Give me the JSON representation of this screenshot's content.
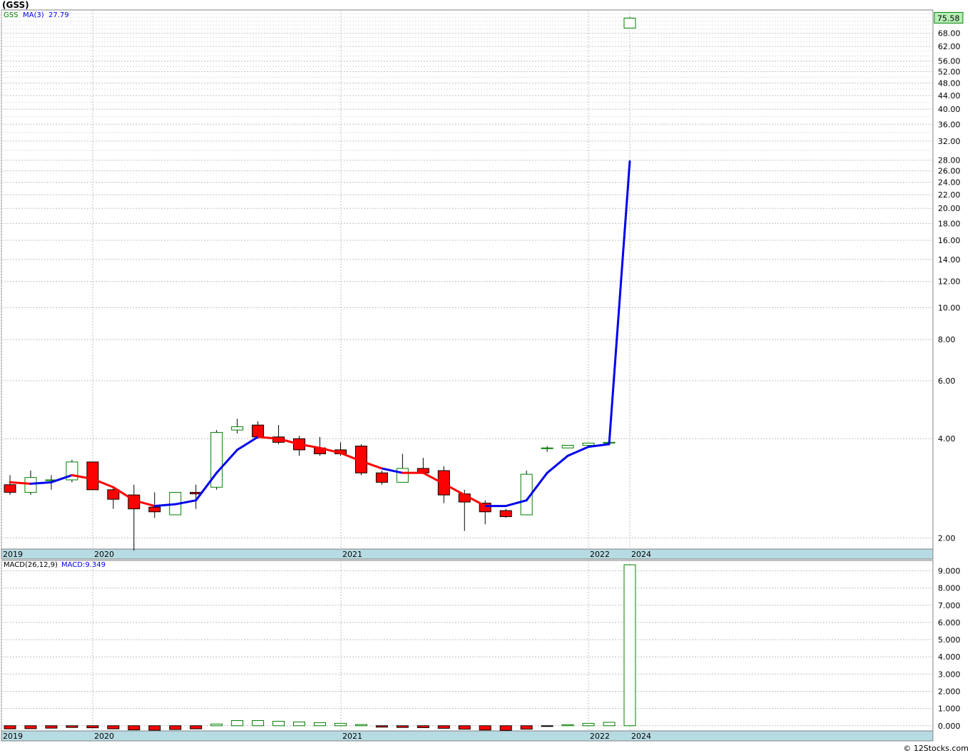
{
  "header": {
    "title": "(GSS)"
  },
  "footer": {
    "credit": "© 12Stocks.com"
  },
  "chart_data": [
    {
      "type": "candlestick",
      "legend": {
        "symbol": "GSS",
        "ma_label": "MA(3)",
        "ma_value": "27.79"
      },
      "last_price_label": "75.58",
      "y_scale": "log",
      "ylim": [
        1.85,
        80
      ],
      "y_ticks": [
        "68.00",
        "62.00",
        "56.00",
        "52.00",
        "48.00",
        "44.00",
        "40.00",
        "36.00",
        "32.00",
        "28.00",
        "26.00",
        "24.00",
        "22.00",
        "20.00",
        "18.00",
        "16.00",
        "14.00",
        "12.00",
        "10.00",
        "8.00",
        "6.00",
        "4.00",
        "2.00"
      ],
      "x_labels": [
        "2019",
        "2020",
        "2021",
        "2022",
        "2024"
      ],
      "colors": {
        "up": "#008000",
        "down": "#ff0000",
        "ma_up": "#0000ee",
        "ma_down": "#ff0000",
        "grid": "#c0c0c0",
        "axis_band": "#b7dbe3",
        "last_price_bg": "#b7f0b7"
      },
      "candles": [
        {
          "o": 2.9,
          "h": 3.1,
          "l": 2.7,
          "c": 2.75
        },
        {
          "o": 2.75,
          "h": 3.2,
          "l": 2.7,
          "c": 3.05
        },
        {
          "o": 3.0,
          "h": 3.1,
          "l": 2.8,
          "c": 3.0
        },
        {
          "o": 3.0,
          "h": 3.45,
          "l": 2.95,
          "c": 3.4
        },
        {
          "o": 3.4,
          "h": 3.4,
          "l": 2.8,
          "c": 2.8
        },
        {
          "o": 2.8,
          "h": 2.85,
          "l": 2.45,
          "c": 2.62
        },
        {
          "o": 2.7,
          "h": 2.9,
          "l": 1.83,
          "c": 2.45
        },
        {
          "o": 2.48,
          "h": 2.75,
          "l": 2.3,
          "c": 2.4
        },
        {
          "o": 2.35,
          "h": 2.7,
          "l": 2.35,
          "c": 2.75
        },
        {
          "o": 2.75,
          "h": 2.9,
          "l": 2.45,
          "c": 2.72
        },
        {
          "o": 2.85,
          "h": 4.25,
          "l": 2.8,
          "c": 4.18
        },
        {
          "o": 4.25,
          "h": 4.6,
          "l": 4.15,
          "c": 4.35
        },
        {
          "o": 4.4,
          "h": 4.52,
          "l": 4.0,
          "c": 4.05
        },
        {
          "o": 4.05,
          "h": 4.4,
          "l": 3.85,
          "c": 3.9
        },
        {
          "o": 4.0,
          "h": 4.08,
          "l": 3.55,
          "c": 3.7
        },
        {
          "o": 3.75,
          "h": 4.05,
          "l": 3.55,
          "c": 3.6
        },
        {
          "o": 3.7,
          "h": 3.9,
          "l": 3.55,
          "c": 3.6
        },
        {
          "o": 3.8,
          "h": 3.85,
          "l": 3.1,
          "c": 3.15
        },
        {
          "o": 3.15,
          "h": 3.2,
          "l": 2.9,
          "c": 2.95
        },
        {
          "o": 2.95,
          "h": 3.6,
          "l": 2.95,
          "c": 3.25
        },
        {
          "o": 3.25,
          "h": 3.5,
          "l": 3.15,
          "c": 3.15
        },
        {
          "o": 3.2,
          "h": 3.3,
          "l": 2.55,
          "c": 2.7
        },
        {
          "o": 2.72,
          "h": 2.8,
          "l": 2.1,
          "c": 2.57
        },
        {
          "o": 2.55,
          "h": 2.6,
          "l": 2.2,
          "c": 2.4
        },
        {
          "o": 2.42,
          "h": 2.45,
          "l": 2.3,
          "c": 2.32
        },
        {
          "o": 2.35,
          "h": 3.2,
          "l": 2.35,
          "c": 3.12
        },
        {
          "o": 3.75,
          "h": 3.8,
          "l": 3.65,
          "c": 3.75
        },
        {
          "o": 3.75,
          "h": 3.82,
          "l": 3.75,
          "c": 3.82
        },
        {
          "o": 3.82,
          "h": 3.88,
          "l": 3.82,
          "c": 3.88
        },
        {
          "o": 3.88,
          "h": 3.9,
          "l": 3.88,
          "c": 3.9
        },
        {
          "o": 70.5,
          "h": 76.0,
          "l": 70.5,
          "c": 75.58
        }
      ],
      "ma": [
        2.95,
        2.92,
        2.95,
        3.1,
        3.02,
        2.85,
        2.6,
        2.5,
        2.53,
        2.6,
        3.15,
        3.7,
        4.05,
        null,
        null,
        null,
        null,
        null,
        3.25,
        3.15,
        3.15,
        null,
        null,
        2.5,
        2.5,
        2.6,
        3.15,
        3.55,
        3.78,
        3.85,
        27.79
      ],
      "ma_colors": [
        "down",
        "down",
        "up",
        "up",
        "down",
        "down",
        "down",
        "down",
        "up",
        "up",
        "up",
        "up",
        "up",
        "down",
        "down",
        "down",
        "down",
        "down",
        "down",
        "up",
        "down",
        "down",
        "down",
        "down",
        "up",
        "up",
        "up",
        "up",
        "up",
        "up",
        "up"
      ]
    },
    {
      "type": "bar",
      "legend": {
        "name": "MACD(26,12,9)",
        "value_label": "MACD:9.349"
      },
      "ylim": [
        -0.3,
        9.6
      ],
      "y_ticks": [
        "9.000",
        "8.000",
        "7.000",
        "6.000",
        "5.000",
        "4.000",
        "3.000",
        "2.000",
        "1.000",
        "0.000"
      ],
      "x_labels": [
        "2019",
        "2020",
        "2021",
        "2022",
        "2024"
      ],
      "values": [
        -0.18,
        -0.17,
        -0.14,
        -0.1,
        -0.12,
        -0.18,
        -0.24,
        -0.26,
        -0.22,
        -0.18,
        0.1,
        0.3,
        0.3,
        0.26,
        0.22,
        0.18,
        0.14,
        0.07,
        -0.08,
        -0.1,
        -0.11,
        -0.15,
        -0.2,
        -0.25,
        -0.27,
        -0.2,
        -0.03,
        0.06,
        0.14,
        0.2,
        9.349
      ]
    }
  ]
}
